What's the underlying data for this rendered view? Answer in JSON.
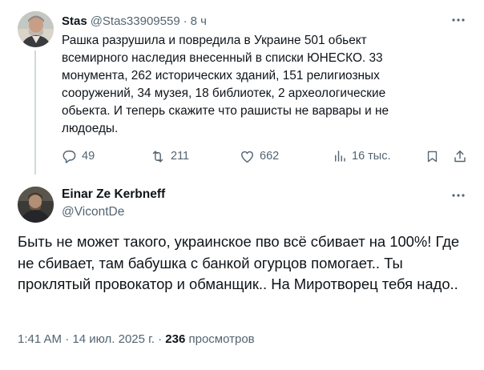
{
  "parent_tweet": {
    "author_name": "Stas",
    "author_handle": "@Stas33909559",
    "separator": "·",
    "time": "8 ч",
    "text": "Рашка разрушила и повредила в Украине 501 обьект всемирного наследия внесенный в списки ЮНЕСКО. 33 монумента, 262 исторических зданий, 151 религиозных сооружений, 34 музея, 18 библиотек, 2 археологические обьекта. И теперь скажите что рашисты не варвары и не людоеды.",
    "actions": {
      "replies": "49",
      "reposts": "211",
      "likes": "662",
      "views": "16 тыс."
    }
  },
  "reply_tweet": {
    "author_name": "Einar Ze Kerbneff",
    "author_handle": "@VicontDe",
    "text": "Быть не может такого, украинское пво всё сбивает на 100%! Где не сбивает, там бабушка с банкой огурцов помогает.. Ты проклятый провокатор и обманщик.. На Миротворец тебя надо..",
    "timestamp": "1:41 AM · 14 июл. 2025 г. · ",
    "views_count": "236",
    "views_label": " просмотров"
  },
  "icons": {
    "more": "more-dots-icon",
    "reply": "reply-bubble-icon",
    "repost": "repost-arrows-icon",
    "like": "heart-icon",
    "views": "views-bars-icon",
    "bookmark": "bookmark-icon",
    "share": "share-upload-icon"
  },
  "colors": {
    "text_primary": "#0f1419",
    "text_secondary": "#536471",
    "thread_line": "#cfd9de",
    "background": "#ffffff"
  }
}
